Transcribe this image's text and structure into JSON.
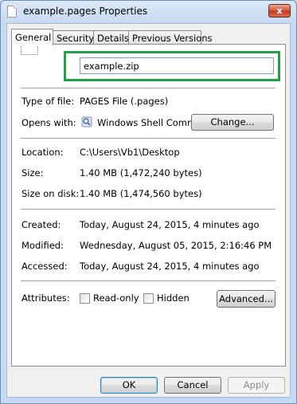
{
  "window": {
    "title": "example.pages Properties",
    "close_label": "x"
  },
  "tabs": [
    "General",
    "Security",
    "Details",
    "Previous Versions"
  ],
  "general": {
    "file_name_value": "example.zip",
    "type_label": "Type of file:",
    "type_value": "PAGES File (.pages)",
    "opens_label": "Opens with:",
    "opens_value": "Windows Shell Commor",
    "change_button": "Change...",
    "location_label": "Location:",
    "location_value": "C:\\Users\\Vb1\\Desktop",
    "size_label": "Size:",
    "size_value": "1.40 MB (1,472,240 bytes)",
    "size_on_disk_label": "Size on disk:",
    "size_on_disk_value": "1.40 MB (1,474,560 bytes)",
    "created_label": "Created:",
    "created_value": "Today, August 24, 2015, 4 minutes ago",
    "modified_label": "Modified:",
    "modified_value": "Wednesday, August 05, 2015, 2:16:46 PM",
    "accessed_label": "Accessed:",
    "accessed_value": "Today, August 24, 2015, 4 minutes ago",
    "attributes_label": "Attributes:",
    "readonly_label": "Read-only",
    "readonly_checked": false,
    "hidden_label": "Hidden",
    "hidden_checked": false,
    "advanced_button": "Advanced..."
  },
  "footer": {
    "ok": "OK",
    "cancel": "Cancel",
    "apply": "Apply"
  },
  "colors": {
    "highlight": "#21a24a",
    "close_button": "#c0391b"
  },
  "icons": {
    "file": "blank-file-icon",
    "app": "windows-shell-icon"
  }
}
